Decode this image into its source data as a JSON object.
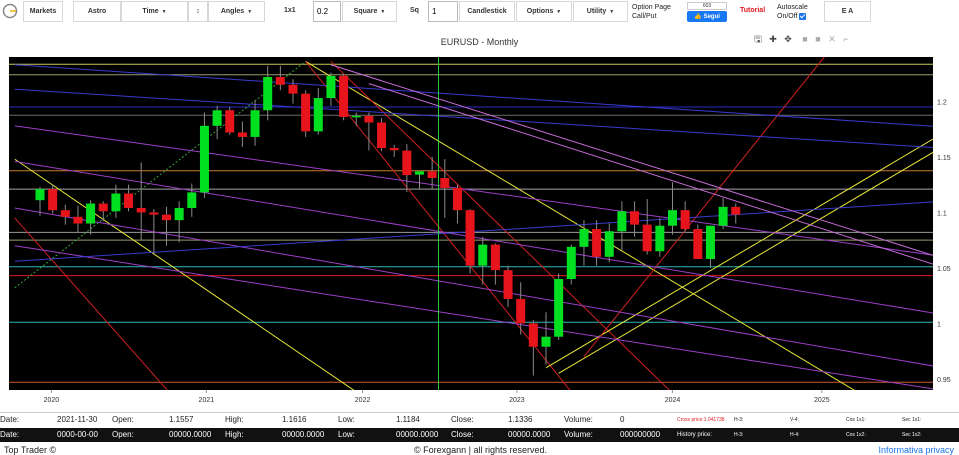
{
  "toolbar": {
    "markets": "Markets",
    "astro": "Astro",
    "time": "Time",
    "updown": "↕",
    "angles": "Angles",
    "ratio": "1x1",
    "ratio_value": "0.2",
    "square": "Square",
    "sq_label": "Sq",
    "sq_value": "1",
    "candlestick": "Candlestick",
    "options": "Options",
    "utility": "Utility",
    "option_page_line1": "Option Page",
    "option_page_line2": "Call/Put",
    "fb_count": "603",
    "fb_label": "Segui",
    "tutorial": "Tutorial",
    "autoscale_line1": "Autoscale",
    "autoscale_line2": "On/Off",
    "ea": "E A"
  },
  "chart_title": "EURUSD - Monthly",
  "chart_tools": [
    "save-icon",
    "zoom-icon",
    "pan-icon",
    "zoom-in-icon",
    "zoom-out-icon",
    "autoscale-icon",
    "reset-icon"
  ],
  "chart_data": {
    "type": "candlestick",
    "title": "EURUSD - Monthly",
    "y_ticks": [
      "1.2",
      "1.15",
      "1.1",
      "1.05",
      "1",
      "0.95"
    ],
    "x_ticks": [
      "2020",
      "2021",
      "2022",
      "2023",
      "2024",
      "2025"
    ],
    "ylim": [
      0.94,
      1.24
    ],
    "colors": {
      "up": "#00e020",
      "down": "#e8141b",
      "background": "#000000"
    },
    "candles": [
      {
        "o": 1.111,
        "h": 1.123,
        "l": 1.097,
        "c": 1.121
      },
      {
        "o": 1.121,
        "h": 1.125,
        "l": 1.099,
        "c": 1.102
      },
      {
        "o": 1.102,
        "h": 1.107,
        "l": 1.089,
        "c": 1.096
      },
      {
        "o": 1.096,
        "h": 1.106,
        "l": 1.082,
        "c": 1.09
      },
      {
        "o": 1.09,
        "h": 1.111,
        "l": 1.08,
        "c": 1.108
      },
      {
        "o": 1.108,
        "h": 1.11,
        "l": 1.092,
        "c": 1.101
      },
      {
        "o": 1.101,
        "h": 1.125,
        "l": 1.095,
        "c": 1.117
      },
      {
        "o": 1.117,
        "h": 1.125,
        "l": 1.101,
        "c": 1.104
      },
      {
        "o": 1.104,
        "h": 1.145,
        "l": 1.075,
        "c": 1.1
      },
      {
        "o": 1.1,
        "h": 1.103,
        "l": 1.063,
        "c": 1.098
      },
      {
        "o": 1.098,
        "h": 1.105,
        "l": 1.07,
        "c": 1.093
      },
      {
        "o": 1.093,
        "h": 1.11,
        "l": 1.073,
        "c": 1.104
      },
      {
        "o": 1.104,
        "h": 1.126,
        "l": 1.096,
        "c": 1.118
      },
      {
        "o": 1.118,
        "h": 1.19,
        "l": 1.113,
        "c": 1.178
      },
      {
        "o": 1.178,
        "h": 1.196,
        "l": 1.166,
        "c": 1.192
      },
      {
        "o": 1.192,
        "h": 1.195,
        "l": 1.17,
        "c": 1.172
      },
      {
        "o": 1.172,
        "h": 1.182,
        "l": 1.159,
        "c": 1.168
      },
      {
        "o": 1.168,
        "h": 1.201,
        "l": 1.16,
        "c": 1.192
      },
      {
        "o": 1.192,
        "h": 1.232,
        "l": 1.183,
        "c": 1.222
      },
      {
        "o": 1.222,
        "h": 1.232,
        "l": 1.21,
        "c": 1.215
      },
      {
        "o": 1.215,
        "h": 1.22,
        "l": 1.198,
        "c": 1.207
      },
      {
        "o": 1.207,
        "h": 1.21,
        "l": 1.168,
        "c": 1.173
      },
      {
        "o": 1.173,
        "h": 1.212,
        "l": 1.17,
        "c": 1.203
      },
      {
        "o": 1.203,
        "h": 1.226,
        "l": 1.196,
        "c": 1.223
      },
      {
        "o": 1.223,
        "h": 1.225,
        "l": 1.183,
        "c": 1.186
      },
      {
        "o": 1.186,
        "h": 1.19,
        "l": 1.178,
        "c": 1.187
      },
      {
        "o": 1.187,
        "h": 1.19,
        "l": 1.156,
        "c": 1.181
      },
      {
        "o": 1.181,
        "h": 1.185,
        "l": 1.155,
        "c": 1.158
      },
      {
        "o": 1.158,
        "h": 1.161,
        "l": 1.15,
        "c": 1.156
      },
      {
        "o": 1.1557,
        "h": 1.1616,
        "l": 1.1184,
        "c": 1.1336
      },
      {
        "o": 1.134,
        "h": 1.137,
        "l": 1.121,
        "c": 1.137
      },
      {
        "o": 1.137,
        "h": 1.15,
        "l": 1.121,
        "c": 1.131
      },
      {
        "o": 1.131,
        "h": 1.148,
        "l": 1.095,
        "c": 1.122
      },
      {
        "o": 1.122,
        "h": 1.125,
        "l": 1.09,
        "c": 1.102
      },
      {
        "o": 1.102,
        "h": 1.103,
        "l": 1.045,
        "c": 1.052
      },
      {
        "o": 1.052,
        "h": 1.078,
        "l": 1.035,
        "c": 1.071
      },
      {
        "o": 1.071,
        "h": 1.072,
        "l": 1.035,
        "c": 1.048
      },
      {
        "o": 1.048,
        "h": 1.052,
        "l": 1.015,
        "c": 1.022
      },
      {
        "o": 1.022,
        "h": 1.037,
        "l": 0.99,
        "c": 1.0
      },
      {
        "o": 1.0,
        "h": 1.003,
        "l": 0.953,
        "c": 0.979
      },
      {
        "o": 0.979,
        "h": 1.01,
        "l": 0.963,
        "c": 0.988
      },
      {
        "o": 0.988,
        "h": 1.045,
        "l": 0.985,
        "c": 1.04
      },
      {
        "o": 1.04,
        "h": 1.071,
        "l": 1.035,
        "c": 1.069
      },
      {
        "o": 1.069,
        "h": 1.093,
        "l": 1.052,
        "c": 1.085
      },
      {
        "o": 1.085,
        "h": 1.093,
        "l": 1.052,
        "c": 1.06
      },
      {
        "o": 1.06,
        "h": 1.09,
        "l": 1.055,
        "c": 1.083
      },
      {
        "o": 1.083,
        "h": 1.11,
        "l": 1.066,
        "c": 1.101
      },
      {
        "o": 1.101,
        "h": 1.11,
        "l": 1.078,
        "c": 1.089
      },
      {
        "o": 1.089,
        "h": 1.112,
        "l": 1.062,
        "c": 1.065
      },
      {
        "o": 1.065,
        "h": 1.095,
        "l": 1.06,
        "c": 1.088
      },
      {
        "o": 1.088,
        "h": 1.127,
        "l": 1.08,
        "c": 1.102
      },
      {
        "o": 1.102,
        "h": 1.11,
        "l": 1.083,
        "c": 1.085
      },
      {
        "o": 1.085,
        "h": 1.089,
        "l": 1.06,
        "c": 1.058
      },
      {
        "o": 1.058,
        "h": 1.088,
        "l": 1.05,
        "c": 1.088
      },
      {
        "o": 1.088,
        "h": 1.113,
        "l": 1.085,
        "c": 1.105
      },
      {
        "o": 1.105,
        "h": 1.108,
        "l": 1.09,
        "c": 1.098
      }
    ],
    "horizontal_lines": [
      {
        "y": 1.2335,
        "color": "#c8c852"
      },
      {
        "y": 1.224,
        "color": "#9b9b72"
      },
      {
        "y": 1.195,
        "color": "#2d2dbf"
      },
      {
        "y": 1.1875,
        "color": "#6b6b6b"
      },
      {
        "y": 1.1375,
        "color": "#c87a2d"
      },
      {
        "y": 1.121,
        "color": "#a7a7a7"
      },
      {
        "y": 1.082,
        "color": "#9a9a9a"
      },
      {
        "y": 1.075,
        "color": "#9b9b72"
      },
      {
        "y": 1.051,
        "color": "#2db5b5"
      },
      {
        "y": 1.043,
        "color": "#e0191e"
      },
      {
        "y": 1.001,
        "color": "#2db5b5"
      },
      {
        "y": 0.947,
        "color": "#c85a2d"
      }
    ],
    "angle_lines": [
      {
        "p1": [
          -2,
          1.032
        ],
        "p2": [
          21,
          1.236
        ],
        "color": "#3aa63a",
        "dash": true
      },
      {
        "p1": [
          21,
          1.236
        ],
        "p2": [
          68,
          0.915
        ],
        "color": "#e8e837"
      },
      {
        "p1": [
          21,
          1.236
        ],
        "p2": [
          44,
          0.91
        ],
        "color": "#d02020"
      },
      {
        "p1": [
          23,
          1.236
        ],
        "p2": [
          52,
          0.915
        ],
        "color": "#d02020"
      },
      {
        "p1": [
          -2,
          1.148
        ],
        "p2": [
          28,
          0.915
        ],
        "color": "#e8e837"
      },
      {
        "p1": [
          -2,
          1.095
        ],
        "p2": [
          12,
          0.915
        ],
        "color": "#d02020"
      },
      {
        "p1": [
          41,
          0.955
        ],
        "p2": [
          74,
          1.177
        ],
        "color": "#e8e837"
      },
      {
        "p1": [
          40,
          0.96
        ],
        "p2": [
          74,
          1.189
        ],
        "color": "#e8e837"
      },
      {
        "p1": [
          43,
          0.97
        ],
        "p2": [
          62,
          1.24
        ],
        "color": "#d02020"
      },
      {
        "p1": [
          -2,
          1.178
        ],
        "p2": [
          74,
          1.056
        ],
        "color": "#9d3fc9"
      },
      {
        "p1": [
          -2,
          1.146
        ],
        "p2": [
          74,
          1.003
        ],
        "color": "#9d3fc9"
      },
      {
        "p1": [
          -2,
          1.104
        ],
        "p2": [
          74,
          0.955
        ],
        "color": "#9d3fc9"
      },
      {
        "p1": [
          -2,
          1.07
        ],
        "p2": [
          74,
          0.935
        ],
        "color": "#9d3fc9"
      },
      {
        "p1": [
          -2,
          1.211
        ],
        "p2": [
          74,
          1.156
        ],
        "color": "#3a3ad0"
      },
      {
        "p1": [
          -2,
          1.233
        ],
        "p2": [
          74,
          1.175
        ],
        "color": "#3a3ad0"
      },
      {
        "p1": [
          -2,
          1.056
        ],
        "p2": [
          74,
          1.112
        ],
        "color": "#3a3ad0"
      },
      {
        "p1": [
          23,
          1.233
        ],
        "p2": [
          74,
          1.049
        ],
        "color": "#c76dd9"
      },
      {
        "p1": [
          26,
          1.216
        ],
        "p2": [
          74,
          1.041
        ],
        "color": "#c76dd9"
      }
    ],
    "vertical_line": {
      "x": 31.5,
      "color": "#2ecc40"
    }
  },
  "info_row_1": {
    "date_label": "Date:",
    "date_value": "2021-11-30",
    "open_label": "Open:",
    "open_value": "1.1557",
    "high_label": "High:",
    "high_value": "1.1616",
    "low_label": "Low:",
    "low_value": "1.1184",
    "close_label": "Close:",
    "close_value": "1.1336",
    "volume_label": "Volume:",
    "volume_value": "0",
    "cross_label": "Cross price:1.041738",
    "h3": "H-3:",
    "v4": "V-4:",
    "cos1": "Cos 1x1:",
    "sec1": "Sec 1x1:"
  },
  "info_row_2": {
    "date_label": "Date:",
    "date_value": "0000-00-00",
    "open_label": "Open:",
    "open_value": "00000.0000",
    "high_label": "High:",
    "high_value": "00000.0000",
    "low_label": "Low:",
    "low_value": "00000.0000",
    "close_label": "Close:",
    "close_value": "00000.0000",
    "volume_label": "Volume:",
    "volume_value": "000000000",
    "history_label": "History price:",
    "h3": "H-3:",
    "h4": "H-4:",
    "cos2": "Cos 1x2:",
    "sec2": "Sec 1x2:"
  },
  "footer": {
    "left": "Top Trader ©",
    "middle": "© Forexgann | all rights reserved.",
    "right": "Informativa privacy"
  }
}
